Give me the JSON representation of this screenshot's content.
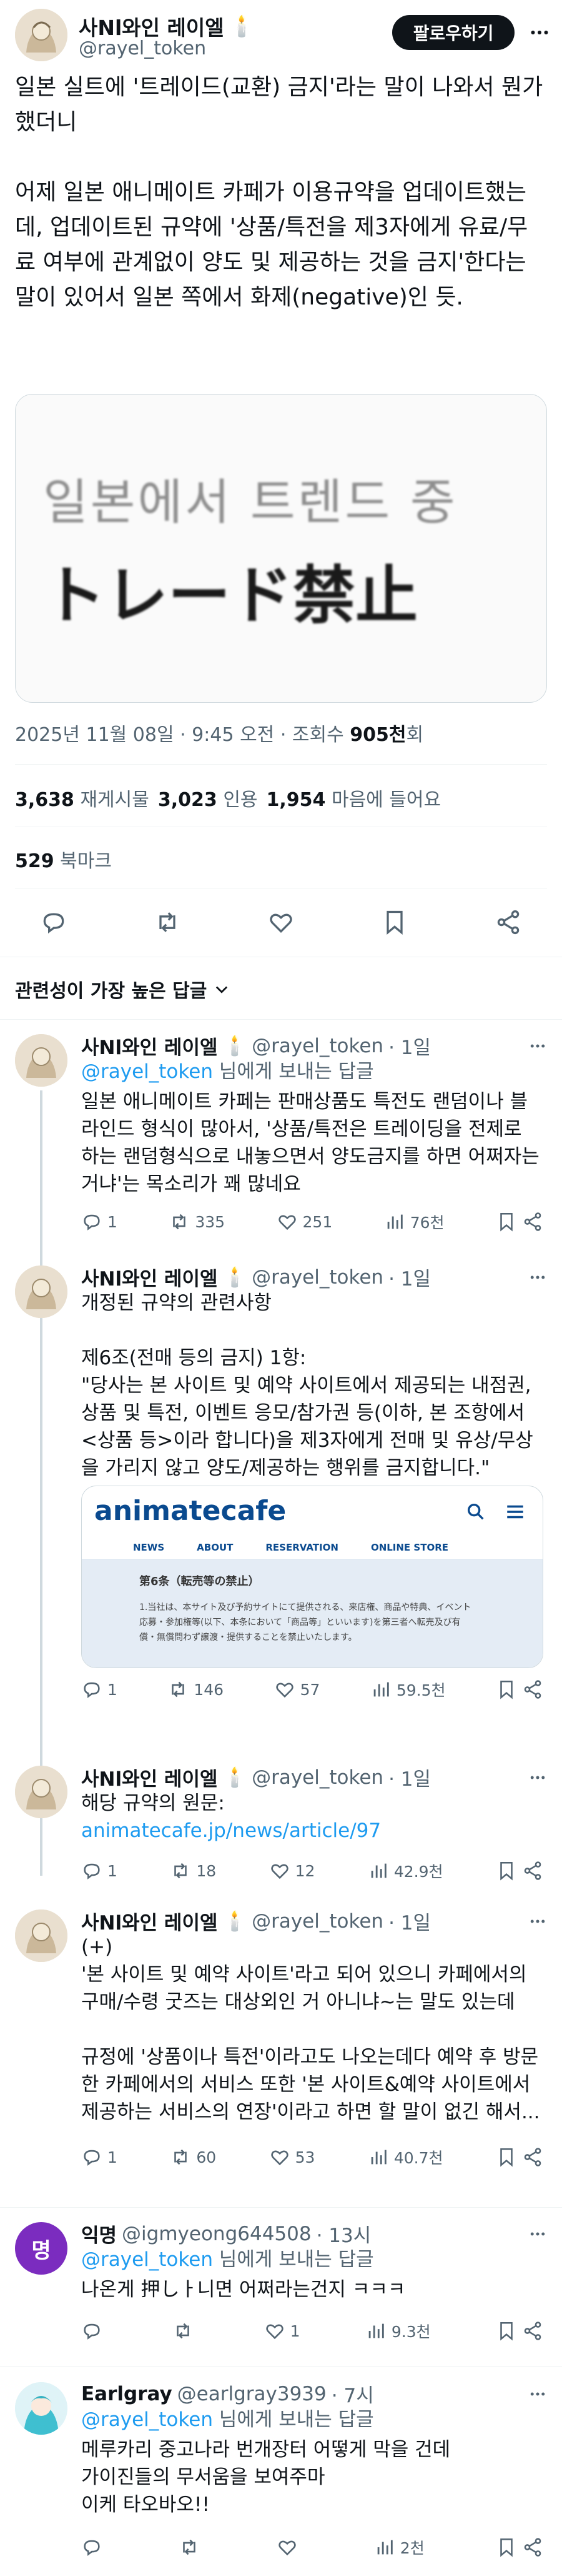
{
  "colors": {
    "accent": "#1d9bf0",
    "text": "#0f1419",
    "muted": "#536471",
    "divider": "#eff3f4"
  },
  "main_post": {
    "author_name": "사Nl와인 레이엘",
    "author_emoji": "🕯️",
    "handle": "@rayel_token",
    "follow_label": "팔로우하기",
    "text": "일본 실트에 '트레이드(교환) 금지'라는 말이 나와서 뭔가 했더니\n\n어제 일본 애니메이트 카페가 이용규약을 업데이트했는데, 업데이트된 규약에 '상품/특전을 제3자에게 유료/무료 여부에 관계없이 양도 및 제공하는 것을 금지'한다는 말이 있어서 일본 쪽에서 화제(negative)인 듯.",
    "image_text_line1": "일본에서 트렌드 중",
    "image_text_line2": "トレード禁止",
    "timestamp": "2025년 11월 08일 · 9:45 오전 · 조회수 ",
    "views_value": "905천",
    "views_suffix": "회",
    "reposts_count": "3,638",
    "reposts_label": "재게시물",
    "quotes_count": "3,023",
    "quotes_label": "인용",
    "likes_count": "1,954",
    "likes_label": "마음에 들어요",
    "bookmarks_count": "529",
    "bookmarks_label": "북마크"
  },
  "sort": {
    "label": "관련성이 가장 높은 답글"
  },
  "replies": [
    {
      "name": "사Nl와인 레이엘",
      "emoji": "🕯️",
      "handle": "@rayel_token",
      "time": "· 1일",
      "reply_to_handle": "@rayel_token",
      "reply_to_suffix": " 님에게 보내는 답글",
      "text": "일본 애니메이트 카페는 판매상품도 특전도 랜덤이나 블라인드 형식이 많아서, '상품/특전은 트레이딩을 전제로 하는 랜덤형식으로 내놓으면서 양도금지를 하면 어쩌자는 거냐'는 목소리가 꽤 많네요",
      "replies": "1",
      "reposts": "335",
      "likes": "251",
      "views": "76천"
    },
    {
      "name": "사Nl와인 레이엘",
      "emoji": "🕯️",
      "handle": "@rayel_token",
      "time": "· 1일",
      "text": "개정된 규약의 관련사항\n\n제6조(전매 등의 금지) 1항:\n\"당사는 본 사이트 및 예약 사이트에서 제공되는 내점권, 상품 및 특전, 이벤트 응모/참가권 등(이하, 본 조항에서 <상품 등>이라 합니다)을 제3자에게 전매 및 유상/무상을 가리지 않고 양도/제공하는 행위를 금지합니다.\"",
      "embed": {
        "logo": "animatecafe",
        "nav": [
          "NEWS",
          "ABOUT",
          "RESERVATION",
          "ONLINE STORE"
        ],
        "heading": "第6条（転売等の禁止）",
        "body": "1.当社は、本サイト及び予約サイトにて提供される、来店権、商品や特典、イベント応募・参加権等(以下、本条において「商品等」といいます)を第三者へ転売及び有償・無償問わず譲渡・提供することを禁止いたします。"
      },
      "replies": "1",
      "reposts": "146",
      "likes": "57",
      "views": "59.5천"
    },
    {
      "name": "사Nl와인 레이엘",
      "emoji": "🕯️",
      "handle": "@rayel_token",
      "time": "· 1일",
      "text": "해당 규약의 원문:",
      "link": "animatecafe.jp/news/article/97",
      "replies": "1",
      "reposts": "18",
      "likes": "12",
      "views": "42.9천"
    },
    {
      "name": "사Nl와인 레이엘",
      "emoji": "🕯️",
      "handle": "@rayel_token",
      "time": "· 1일",
      "text": "(+)\n'본 사이트 및 예약 사이트'라고 되어 있으니 카페에서의 구매/수령 굿즈는 대상외인 거 아니냐~는 말도 있는데\n\n규정에 '상품이나 특전'이라고도 나오는데다 예약 후 방문한 카페에서의 서비스 또한 '본 사이트&예약 사이트에서 제공하는 서비스의 연장'이라고 하면 할 말이 없긴 해서...",
      "replies": "1",
      "reposts": "60",
      "likes": "53",
      "views": "40.7천"
    },
    {
      "name": "익명",
      "handle": "@igmyeong644508",
      "time": "· 13시",
      "avatar_letter": "명",
      "reply_to_handle": "@rayel_token",
      "reply_to_suffix": " 님에게 보내는 답글",
      "text": "나온게 押しㅏ니면 어쩌라는건지 ㅋㅋㅋ",
      "replies": "",
      "reposts": "",
      "likes": "1",
      "views": "9.3천"
    },
    {
      "name": "Earlgray",
      "handle": "@earlgray3939",
      "time": "· 7시",
      "reply_to_handle": "@rayel_token",
      "reply_to_suffix": " 님에게 보내는 답글",
      "text": "메루카리 중고나라 번개장터 어떻게 막을 건데\n가이진들의 무서움을 보여주마\n이케 타오바오!!",
      "replies": "",
      "reposts": "",
      "likes": "",
      "views": "2천"
    }
  ]
}
